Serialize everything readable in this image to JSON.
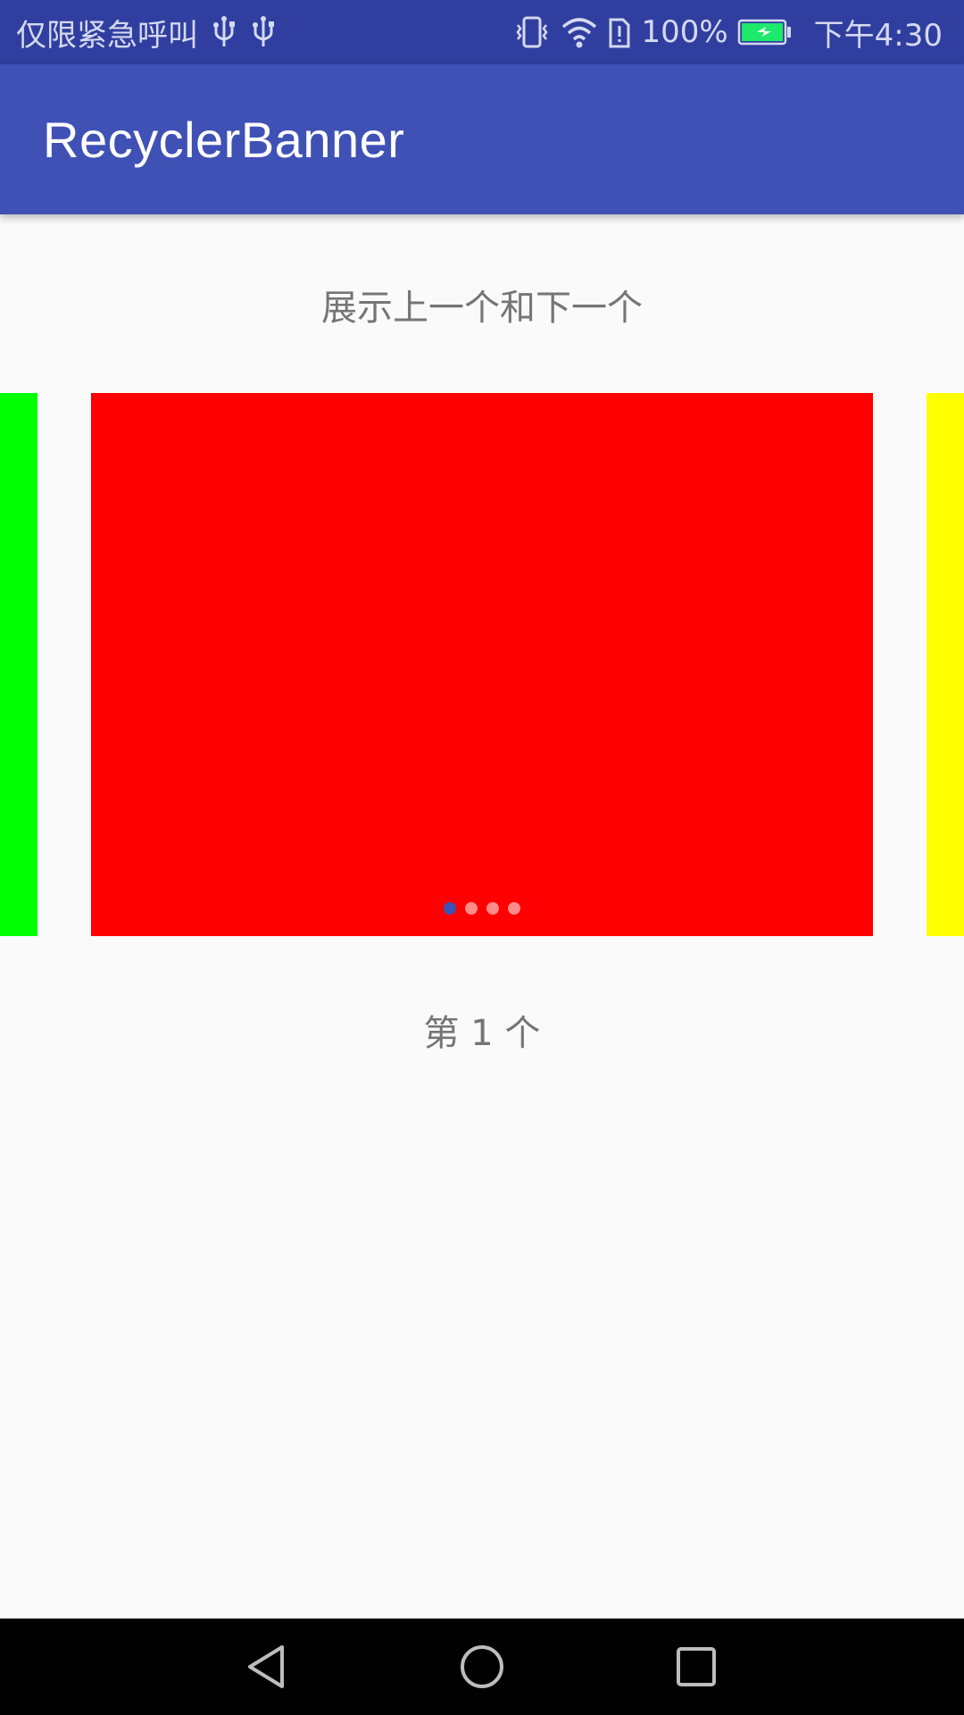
{
  "status_bar": {
    "left_text": "仅限紧急呼叫",
    "icons_left": [
      "usb-icon",
      "usb-icon"
    ],
    "icons_right": [
      "vibrate-icon",
      "wifi-icon",
      "sim-alert-icon",
      "battery-charging-icon"
    ],
    "battery": "100%",
    "time": "下午4:30",
    "bg_color": "#303f9f"
  },
  "app_bar": {
    "title": "RecyclerBanner",
    "bg_color": "#3f51b5"
  },
  "main": {
    "subtitle": "展示上一个和下一个",
    "banner": {
      "pages": [
        {
          "id": "prev",
          "color": "#00ff00"
        },
        {
          "id": "current",
          "color": "#ff0000"
        },
        {
          "id": "next",
          "color": "#ffff00"
        }
      ],
      "indicator": {
        "count": 4,
        "active_index": 0,
        "active_color": "#3f51b5",
        "inactive_color": "#ff8a8a"
      }
    },
    "counter_text": "第 1 个"
  },
  "nav_bar": {
    "buttons": [
      "back-icon",
      "home-icon",
      "recents-icon"
    ]
  }
}
